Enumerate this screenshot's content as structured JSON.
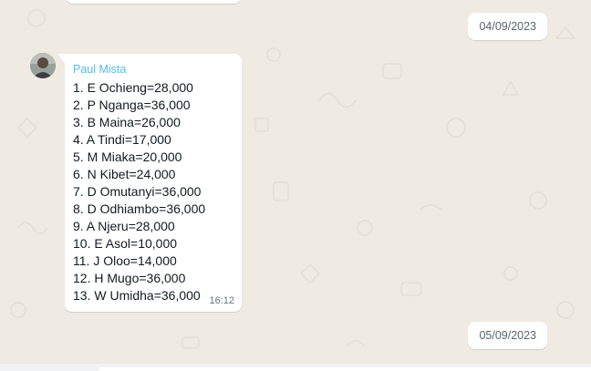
{
  "dates": [
    "04/09/2023",
    "05/09/2023"
  ],
  "message": {
    "sender": "Paul Mista",
    "avatar_icon": "user-avatar-photo",
    "lines": [
      "1. E Ochieng=28,000",
      "2. P Nganga=36,000",
      "3. B Maina=26,000",
      "4. A Tindi=17,000",
      "5. M Miaka=20,000",
      "6. N Kibet=24,000",
      "7. D Omutanyi=36,000",
      "8. D Odhiambo=36,000",
      "9. A Njeru=28,000",
      "10. E Asol=10,000",
      "11. J Oloo=14,000",
      "12. H Mugo=36,000",
      "13. W Umidha=36,000"
    ],
    "time": "16:12"
  },
  "colors": {
    "chat_background": "#efeae2",
    "bubble": "#ffffff",
    "sender_name": "#53bdeb",
    "text": "#111b21",
    "meta": "#667781"
  }
}
